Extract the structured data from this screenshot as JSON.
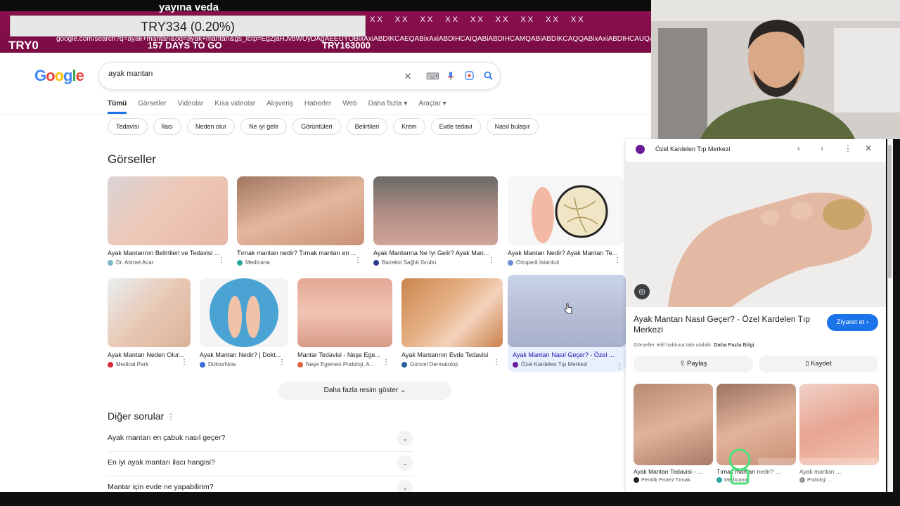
{
  "overlay": {
    "veda": "yayına veda",
    "donation": "TRY334 (0.20%)",
    "ticker": [
      "X X​",
      "X X​",
      "X X​",
      "X X​",
      "X X​",
      "X X​",
      "X X​",
      "X X​",
      "X X​"
    ],
    "url": "google.com/search?q=ayak+mantarı&oq=ayak+mantarı&gs_lcrp=EgZjaHJvbWUyDAgAEEUYOBixAxiABDIKCAEQABixAxiABDIHCAIQABiABDIHCAMQABiABDIKCAQQABixAxiABDIHCAUQABiABDIHCAYQABiABDIHCAcQABiABDIHCAgQABiABDIHCAkQABiABNIBCDE",
    "try_left": "TRY0",
    "days": "157 DAYS TO GO",
    "try_right": "TRY163000"
  },
  "search": {
    "query": "ayak mantarı",
    "tabs": [
      "Tümü",
      "Görseller",
      "Videolar",
      "Kısa videolar",
      "Alışveriş",
      "Haberler",
      "Web",
      "Daha fazla ▾",
      "Araçlar ▾"
    ],
    "chips": [
      "Tedavisi",
      "İlacı",
      "Neden olur",
      "Ne iyi gelir",
      "Görüntüleri",
      "Belirtileri",
      "Krem",
      "Evde tedavi",
      "Nasıl bulaşır"
    ]
  },
  "images_section": {
    "title": "Görseller",
    "row1": [
      {
        "caption": "Ayak Mantarının Belirtileri ve Tedavisi ...",
        "source": "Dr. Ahmet Acar",
        "color": "#7bb7c7"
      },
      {
        "caption": "Tırnak mantarı nedir? Tırnak mantarı en ...",
        "source": "Medicana",
        "color": "#2aa7a0"
      },
      {
        "caption": "Ayak Mantarına Ne İyi Gelir? Ayak Man...",
        "source": "Bazekol Sağlık Grubu",
        "color": "#2a3b8f"
      },
      {
        "caption": "Ayak Mantarı Nedir? Ayak Mantarı Te...",
        "source": "Ortopedi İstanbul",
        "color": "#6d8bd6"
      }
    ],
    "row2": [
      {
        "caption": "Ayak Mantarı Neden Olur...",
        "source": "Medical Park",
        "color": "#d62f3c"
      },
      {
        "caption": "Ayak Mantarı Nedir? | Dokt...",
        "source": "DoktorNow",
        "color": "#3f6ad8"
      },
      {
        "caption": "Mantar Tedavisi - Neşe Ege...",
        "source": "Neşe Egemen Podoloji, A...",
        "color": "#e1653f"
      },
      {
        "caption": "Ayak Mantarının Evde Tedavisi",
        "source": "Güncel Dermatoloji",
        "color": "#2c5f9e"
      },
      {
        "caption": "Ayak Mantarı Nasıl Geçer? - Özel ...",
        "source": "Özel Kardelen Tıp Merkezi",
        "color": "#6a1b9a"
      }
    ],
    "more_button": "Daha fazla resim göster"
  },
  "other_questions": {
    "title": "Diğer sorular",
    "items": [
      "Ayak mantarı en çabuk nasıl geçer?",
      "En iyi ayak mantarı ilacı hangisi?",
      "Mantar için evde ne yapabilirim?"
    ]
  },
  "panel": {
    "site": "Özel Kardelen Tıp Merkezi",
    "title": "Ayak Mantarı Nasıl Geçer? - Özel Kardelen Tıp Merkezi",
    "visit": "Ziyaret et",
    "copyright": "Görseller telif hakkına tabi olabilir.",
    "more_info": "Daha Fazla Bilgi",
    "share": "Paylaş",
    "save": "Kaydet",
    "related": [
      {
        "caption": "Ayak Mantarı Tedavisi - ...",
        "source": "Pendik Protez Tırnak"
      },
      {
        "caption": "Tırnak mantarı nedir? ...",
        "source": "Medicana"
      },
      {
        "caption": "Ayak mantarı ...",
        "source": "Podoloji ..."
      }
    ]
  }
}
